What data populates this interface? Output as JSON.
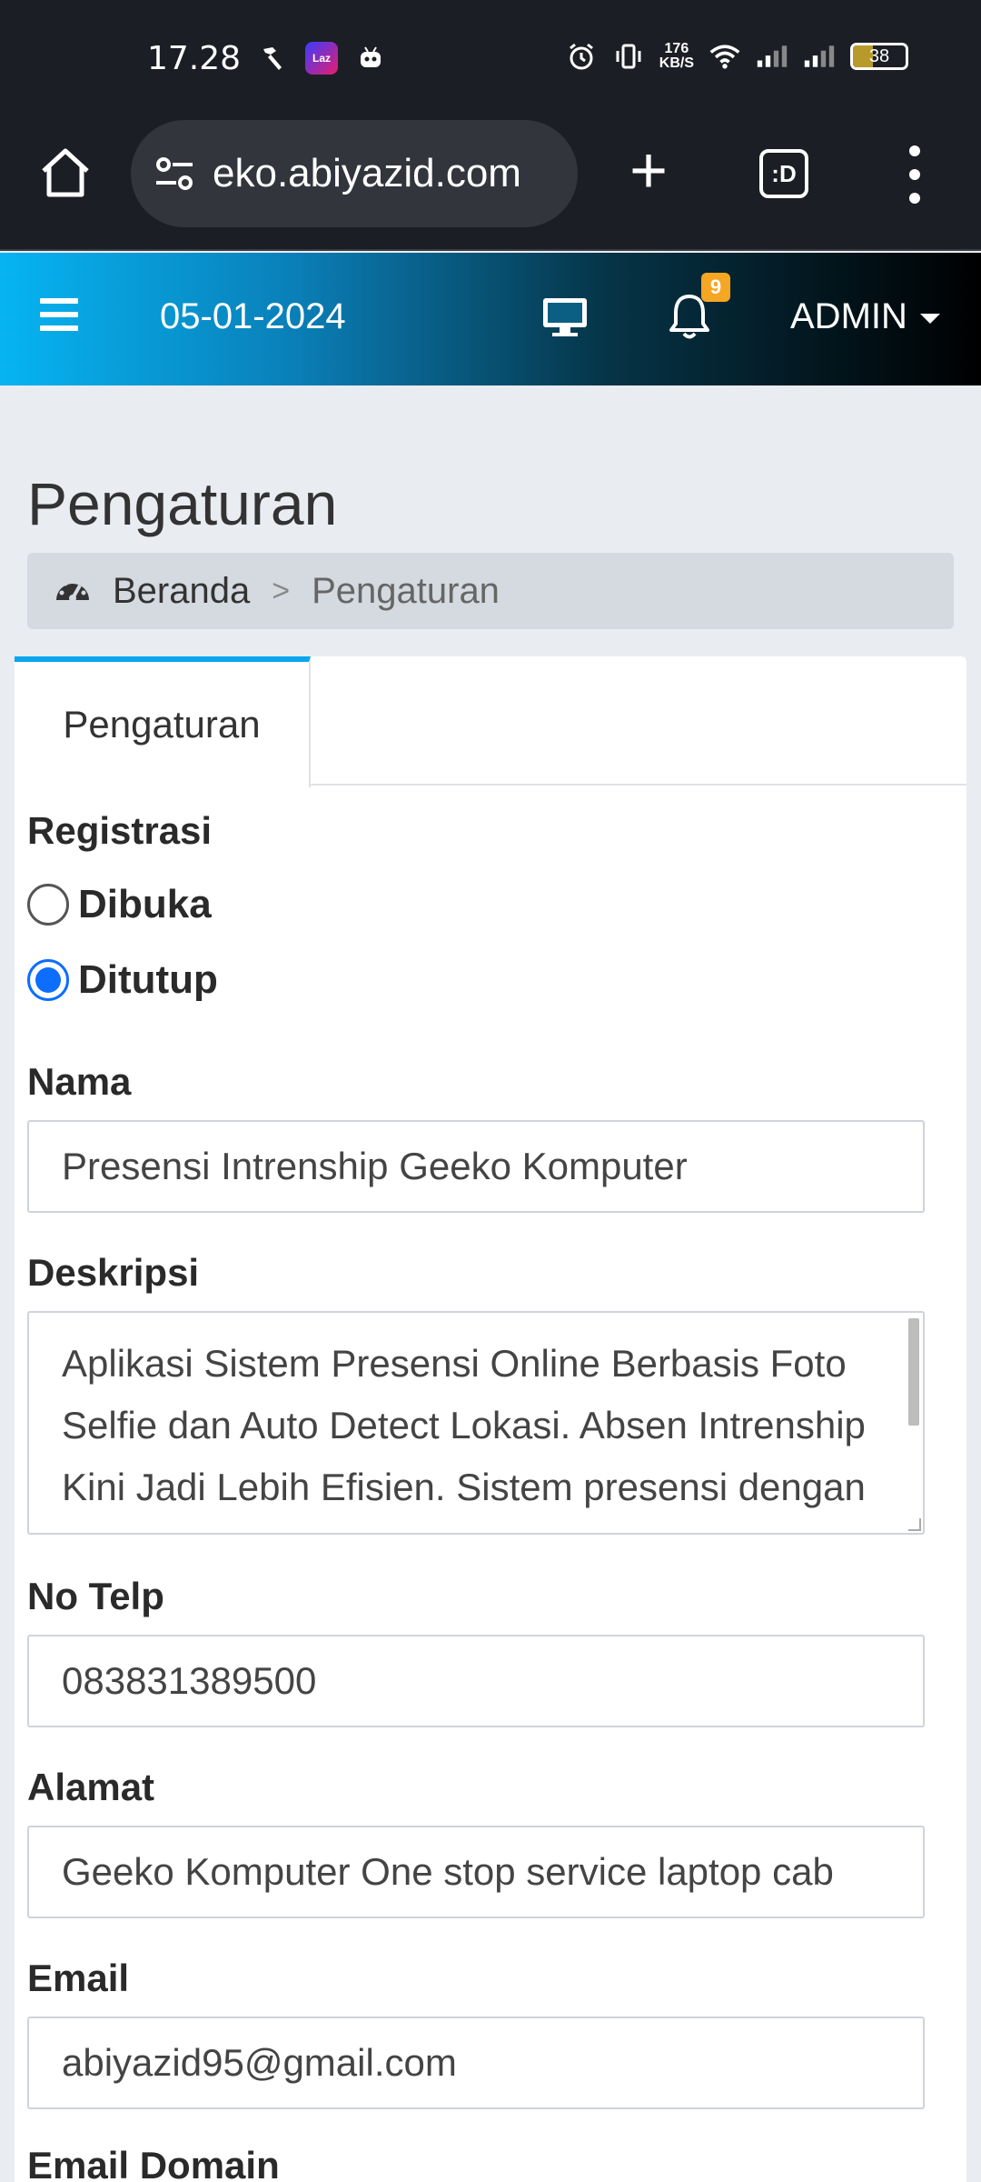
{
  "status_bar": {
    "time": "17.28",
    "net_speed_value": "176",
    "net_speed_unit": "KB/S",
    "battery_level": "38"
  },
  "browser": {
    "url": "eko.abiyazid.com",
    "tabs_label": ":D"
  },
  "header": {
    "date": "05-01-2024",
    "notification_count": "9",
    "user_menu": "ADMIN"
  },
  "page": {
    "title": "Pengaturan",
    "breadcrumb": {
      "home": "Beranda",
      "separator": ">",
      "current": "Pengaturan"
    },
    "tab_label": "Pengaturan"
  },
  "form": {
    "registrasi": {
      "label": "Registrasi",
      "options": [
        "Dibuka",
        "Ditutup"
      ],
      "selected": "Ditutup"
    },
    "nama": {
      "label": "Nama",
      "value": "Presensi Intrenship Geeko Komputer"
    },
    "deskripsi": {
      "label": "Deskripsi",
      "value": "Aplikasi Sistem Presensi Online Berbasis Foto Selfie dan Auto Detect Lokasi. Absen Intrenship Kini Jadi Lebih Efisien. Sistem presensi dengan verifikasi foto selfie"
    },
    "no_telp": {
      "label": "No Telp",
      "value": "083831389500"
    },
    "alamat": {
      "label": "Alamat",
      "value": "Geeko Komputer One stop service laptop cab"
    },
    "email": {
      "label": "Email",
      "value": "abiyazid95@gmail.com"
    },
    "email_domain": {
      "label": "Email Domain"
    }
  }
}
